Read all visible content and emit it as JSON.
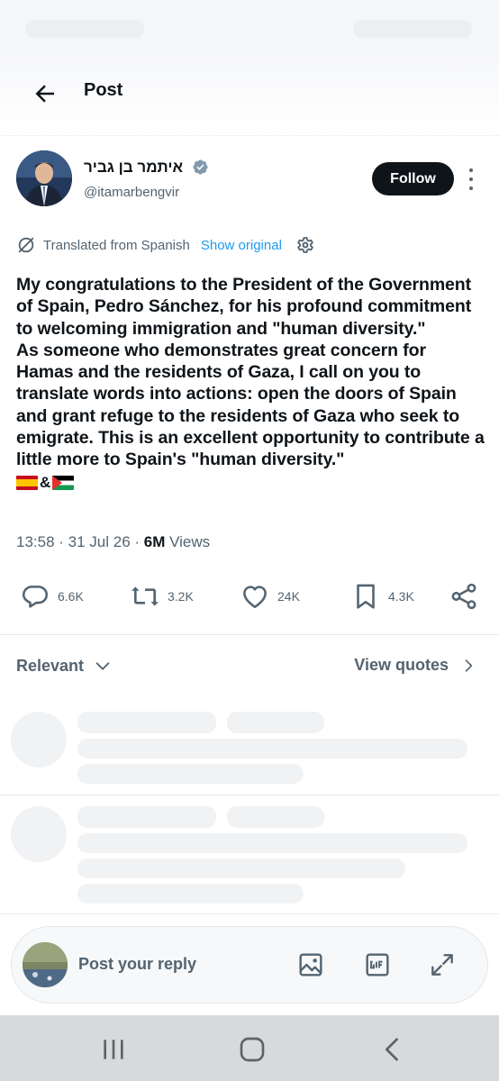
{
  "header": {
    "title": "Post"
  },
  "author": {
    "name": "איתמר בן גביר",
    "handle": "@itamarbengvir",
    "follow_label": "Follow"
  },
  "translation": {
    "label": "Translated from Spanish",
    "show_original": "Show original"
  },
  "post": {
    "paragraphs": [
      "My congratulations to the President of the Government of Spain, Pedro Sánchez, for his profound commitment to welcoming immigration and \"human diversity.\"",
      "As someone who demonstrates great concern for Hamas and the residents of Gaza, I call on you to translate words into actions: open the doors of Spain and grant refuge to the residents of Gaza who seek to emigrate. This is an excellent opportunity to contribute a little more to Spain's \"human diversity.\""
    ],
    "emoji_joiner": "&"
  },
  "meta": {
    "time": "13:58",
    "date": "31 Jul 26",
    "views_count": "6M",
    "views_label": "Views",
    "separator": " · "
  },
  "actions": {
    "replies": "6.6K",
    "reposts": "3.2K",
    "likes": "24K",
    "bookmarks": "4.3K"
  },
  "replies_section": {
    "sort_label": "Relevant",
    "view_quotes": "View quotes"
  },
  "reply_composer": {
    "placeholder": "Post your reply"
  },
  "colors": {
    "accent": "#1d9bf0",
    "text": "#0f1419",
    "secondary": "#536471",
    "follow_bg": "#0f1419"
  }
}
